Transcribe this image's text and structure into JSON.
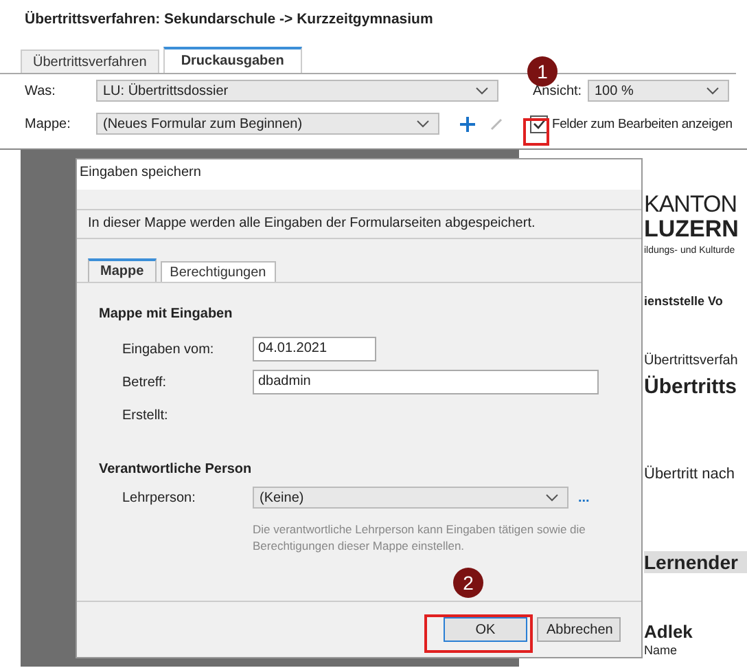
{
  "title": "Übertrittsverfahren: Sekundarschule -> Kurzzeitgymnasium",
  "tabs": [
    {
      "label": "Übertrittsverfahren",
      "selected": false
    },
    {
      "label": "Druckausgaben",
      "selected": true
    }
  ],
  "was": {
    "label": "Was:",
    "value": "LU: Übertrittsdossier"
  },
  "ansicht": {
    "label": "Ansicht:",
    "value": "100 %"
  },
  "mappe": {
    "label": "Mappe:",
    "value": "(Neues Formular zum Beginnen)"
  },
  "edit_fields": {
    "label": "Felder zum Bearbeiten anzeigen",
    "checked": true
  },
  "document": {
    "logo_top": "KANTON",
    "logo_bottom": "LUZERN",
    "department": "ildungs- und Kulturde",
    "office": "ienststelle Vo",
    "line_1": "Übertrittsverfah",
    "heading": "Übertritts",
    "line_2": "Übertritt nach",
    "section": "Lernender",
    "name_value": "Adlek",
    "name_label": "Name"
  },
  "dialog": {
    "title": "Eingaben speichern",
    "info": "In dieser Mappe werden alle Eingaben der Formularseiten abgespeichert.",
    "tabs": [
      {
        "label": "Mappe",
        "selected": true
      },
      {
        "label": "Berechtigungen",
        "selected": false
      }
    ],
    "section_1": "Mappe mit Eingaben",
    "fields": [
      {
        "label": "Eingaben vom:",
        "value": "04.01.2021",
        "kind": "short"
      },
      {
        "label": "Betreff:",
        "value": "dbadmin",
        "kind": "long"
      },
      {
        "label": "Erstellt:",
        "kind": "none"
      }
    ],
    "section_2": "Verantwortliche Person",
    "teacher": {
      "label": "Lehrperson:",
      "value": "(Keine)",
      "more": "..."
    },
    "hint": "Die verantwortliche Lehrperson kann Eingaben tätigen sowie die Berechtigungen dieser Mappe einstellen.",
    "buttons": [
      "OK",
      "Abbrechen"
    ]
  },
  "callouts": [
    "1",
    "2"
  ]
}
